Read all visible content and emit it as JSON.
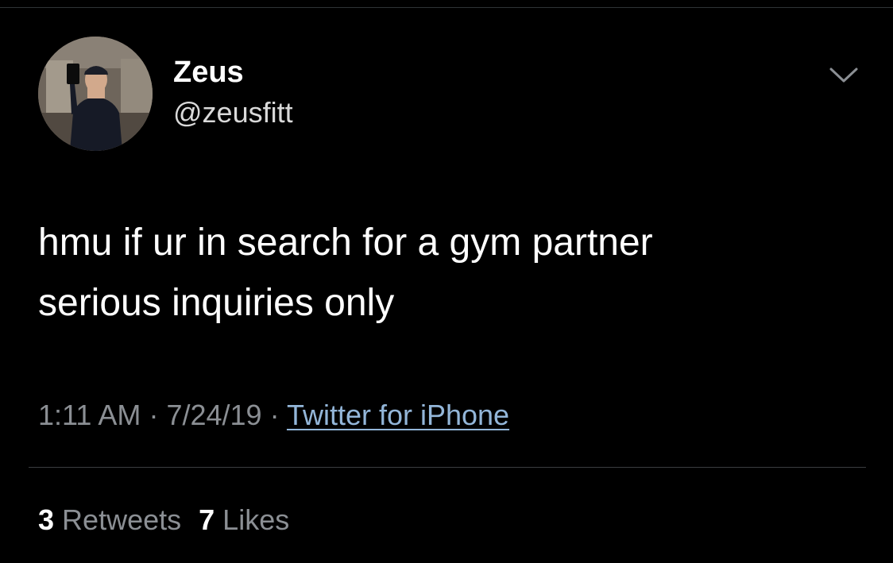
{
  "header": {
    "display_name": "Zeus",
    "handle": "@zeusfitt",
    "avatar_icon": "profile-photo",
    "menu_icon": "chevron-down-icon"
  },
  "tweet": {
    "lines": [
      "hmu if ur in search for a gym partner",
      "serious inquiries only"
    ]
  },
  "meta": {
    "time": "1:11 AM",
    "separator": "·",
    "date": "7/24/19",
    "source": "Twitter for iPhone"
  },
  "stats": {
    "retweets_count": "3",
    "retweets_label": "Retweets",
    "likes_count": "7",
    "likes_label": "Likes"
  },
  "colors": {
    "background": "#000000",
    "text": "#ffffff",
    "muted": "#8b8f94",
    "link": "#93b6d9",
    "divider": "#3a3d40"
  }
}
